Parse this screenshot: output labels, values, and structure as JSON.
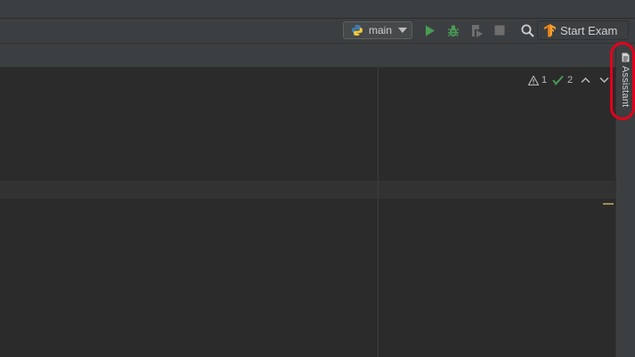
{
  "toolbar": {
    "run_config": {
      "label": "main",
      "icon": "python-icon"
    },
    "buttons": [
      {
        "name": "run",
        "icon": "run-icon",
        "color": "#499c54"
      },
      {
        "name": "debug",
        "icon": "debug-icon",
        "color": "#499c54"
      },
      {
        "name": "coverage",
        "icon": "run-with-coverage-icon",
        "color": "#6e6e6e"
      },
      {
        "name": "stop",
        "icon": "stop-icon",
        "color": "#6e6e6e"
      },
      {
        "name": "search",
        "icon": "search-icon",
        "color": "#cfcfcf"
      }
    ],
    "start_exam": {
      "label": "Start Exam",
      "icon": "tensorflow-icon",
      "color": "#f0a030"
    }
  },
  "inspections": {
    "warnings": "1",
    "weak_warnings": "2"
  },
  "right_sidebar": {
    "assistant": {
      "label": "Assistant",
      "icon": "document-icon"
    }
  }
}
